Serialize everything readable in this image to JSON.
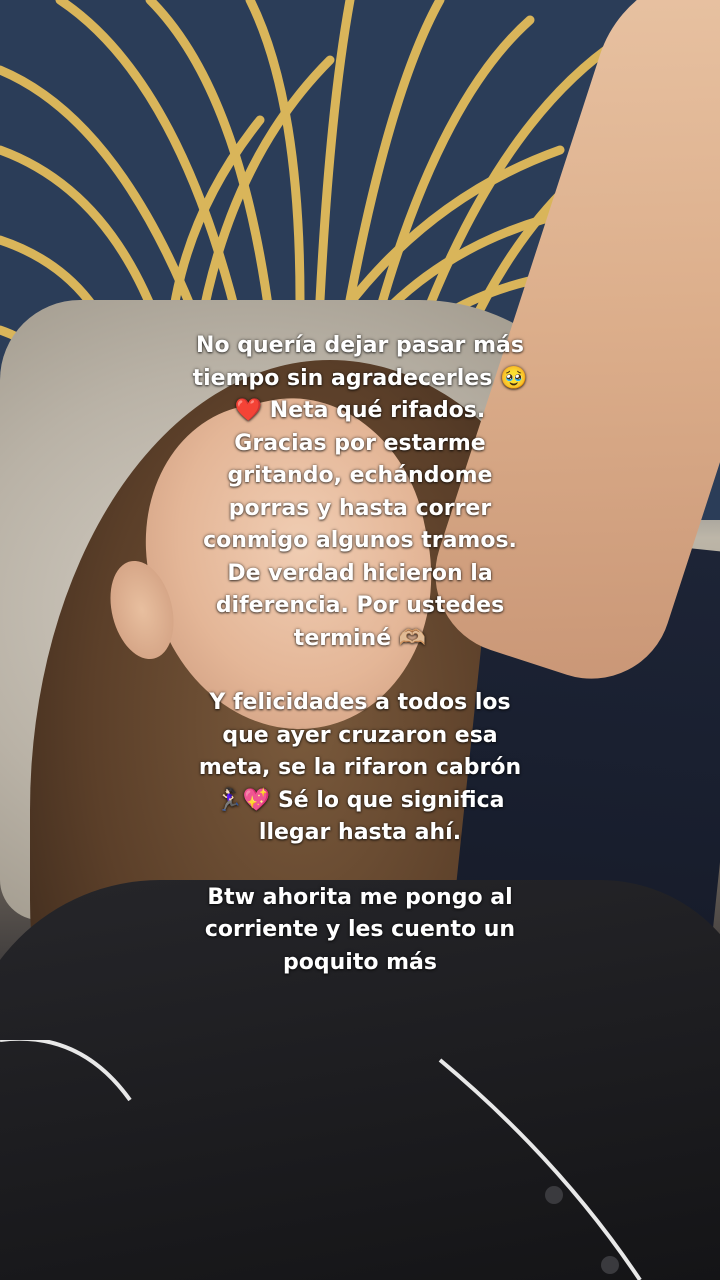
{
  "caption": {
    "paragraph_1": "No quería dejar pasar más tiempo sin agradecerles 🥹❤️ Neta qué rifados. Gracias por estarme gritando, echándome porras y hasta correr conmigo algunos tramos. De verdad hicieron la diferencia. Por ustedes terminé 🫶🏼",
    "paragraph_2": "Y felicidades a todos los que ayer cruzaron esa meta, se la rifaron cabrón 🏃🏻‍♀️💖 Sé lo que significa llegar hasta ahí.",
    "paragraph_3": "Btw  ahorita me pongo al corriente y les cuento un poquito más"
  },
  "colors": {
    "headboard_navy": "#2b3d58",
    "headboard_gold": "#d9b55a",
    "caption_text": "#ffffff"
  }
}
